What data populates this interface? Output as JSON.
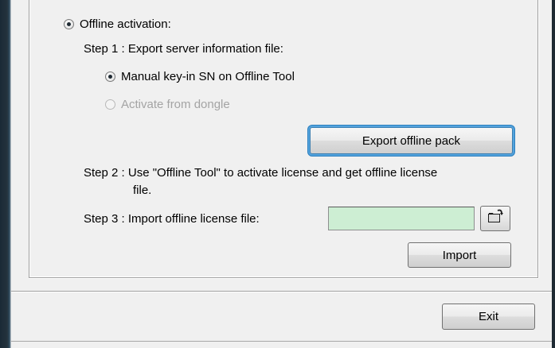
{
  "offline": {
    "activation_label": "Offline activation:",
    "step1": "Step 1 : Export server information file:",
    "manual_label": "Manual key-in SN on Offline Tool",
    "dongle_label": "Activate from dongle",
    "export_button": "Export offline pack",
    "step2_line1": "Step 2 : Use \"Offline Tool\" to activate license and get offline license",
    "step2_line2": "file.",
    "step3": "Step 3 : Import offline license file:",
    "license_file_value": "",
    "import_button": "Import"
  },
  "footer": {
    "exit_button": "Exit"
  },
  "icons": {
    "radio_selected": "radio-selected",
    "browse": "folder-open-icon"
  },
  "colors": {
    "file_field_bg": "#cdeed3",
    "focus_ring": "#53a3dd",
    "dialog_bg": "#f0f0f0"
  }
}
